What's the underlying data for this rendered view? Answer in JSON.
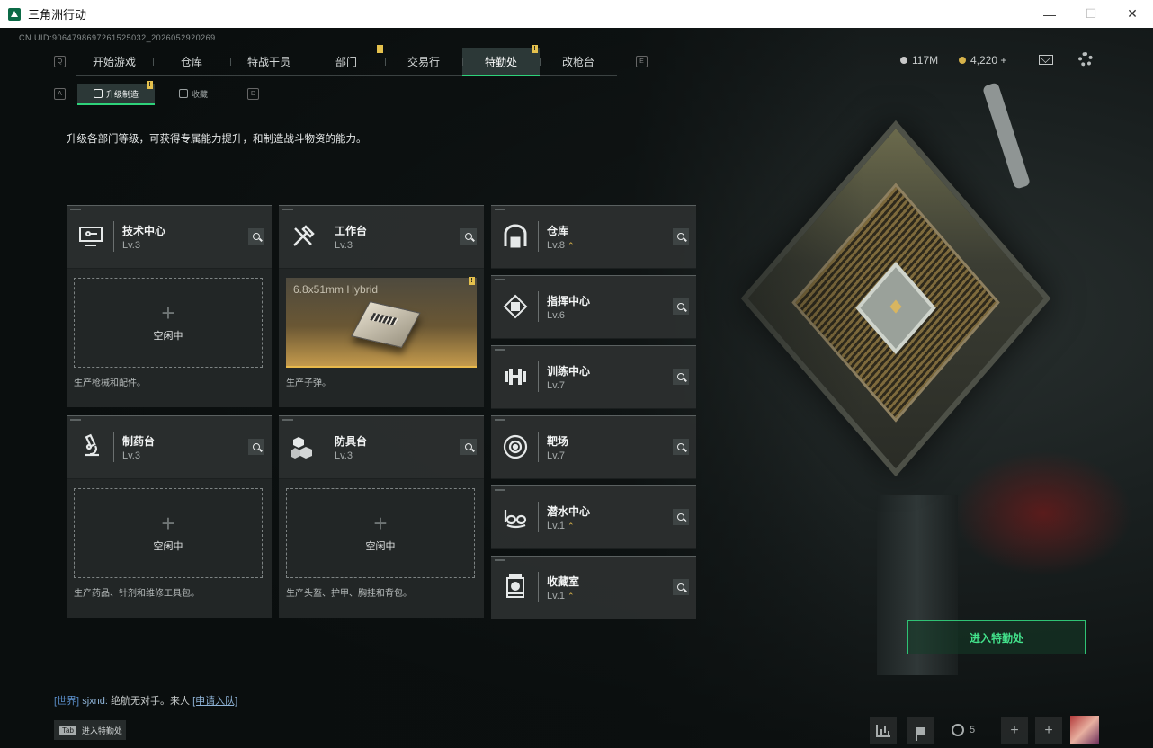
{
  "window": {
    "title": "三角洲行动",
    "controls": {
      "minimize": "—",
      "maximize": "☐",
      "close": "✕"
    }
  },
  "header": {
    "uid": "CN UID:9064798697261525032_2026052920269",
    "nav": [
      {
        "label": "开始游戏",
        "active": false,
        "badge": ""
      },
      {
        "label": "仓库",
        "active": false,
        "badge": ""
      },
      {
        "label": "特战干员",
        "active": false,
        "badge": ""
      },
      {
        "label": "部门",
        "active": false,
        "badge": "!"
      },
      {
        "label": "交易行",
        "active": false,
        "badge": ""
      },
      {
        "label": "特勤处",
        "active": true,
        "badge": "!"
      },
      {
        "label": "改枪台",
        "active": false,
        "badge": ""
      }
    ],
    "key_left": "Q",
    "key_right": "E",
    "resources": [
      {
        "value": "117M",
        "color": "#c8c8c8"
      },
      {
        "value": "4,220 +",
        "color": "#d6b24a"
      }
    ]
  },
  "subtabs": {
    "key_left": "A",
    "key_right": "D",
    "items": [
      {
        "label": "升级制造",
        "active": true,
        "badge": "!"
      },
      {
        "label": "收藏",
        "active": false,
        "badge": ""
      }
    ]
  },
  "description": "升级各部门等级，可获得专属能力提升，和制造战斗物资的能力。",
  "workbenches": [
    {
      "name": "技术中心",
      "level": "Lv.3",
      "icon": "computer-icon",
      "status": "空闲中",
      "produce": "生产枪械和配件。"
    },
    {
      "name": "工作台",
      "level": "Lv.3",
      "icon": "tools-icon",
      "item": "6.8x51mm Hybrid",
      "produce": "生产子弹。"
    },
    {
      "name": "制药台",
      "level": "Lv.3",
      "icon": "microscope-icon",
      "status": "空闲中",
      "produce": "生产药品、针剂和维修工具包。"
    },
    {
      "name": "防具台",
      "level": "Lv.3",
      "icon": "blocks-icon",
      "status": "空闲中",
      "produce": "生产头盔、护甲、胸挂和背包。"
    }
  ],
  "departments": [
    {
      "name": "仓库",
      "level": "Lv.8",
      "upgrade": true,
      "icon": "warehouse-icon"
    },
    {
      "name": "指挥中心",
      "level": "Lv.6",
      "upgrade": false,
      "icon": "chip-icon"
    },
    {
      "name": "训练中心",
      "level": "Lv.7",
      "upgrade": false,
      "icon": "dumbbell-icon"
    },
    {
      "name": "靶场",
      "level": "Lv.7",
      "upgrade": false,
      "icon": "target-icon"
    },
    {
      "name": "潜水中心",
      "level": "Lv.1",
      "upgrade": true,
      "icon": "goggles-icon"
    },
    {
      "name": "收藏室",
      "level": "Lv.1",
      "upgrade": true,
      "icon": "display-case-icon"
    }
  ],
  "upgrade_glyph": "⌃",
  "enter_button": "进入特勤处",
  "chat": {
    "channel": "[世界]",
    "name": "sjxnd:",
    "message": "绝航无对手。来人",
    "link": "[申请入队]"
  },
  "tab_hint": {
    "key": "Tab",
    "label": "进入特勤处"
  },
  "friends_count": "5",
  "colors": {
    "accent": "#2ed27a",
    "badge": "#e5c14d",
    "upgrade": "#d9b34a"
  }
}
